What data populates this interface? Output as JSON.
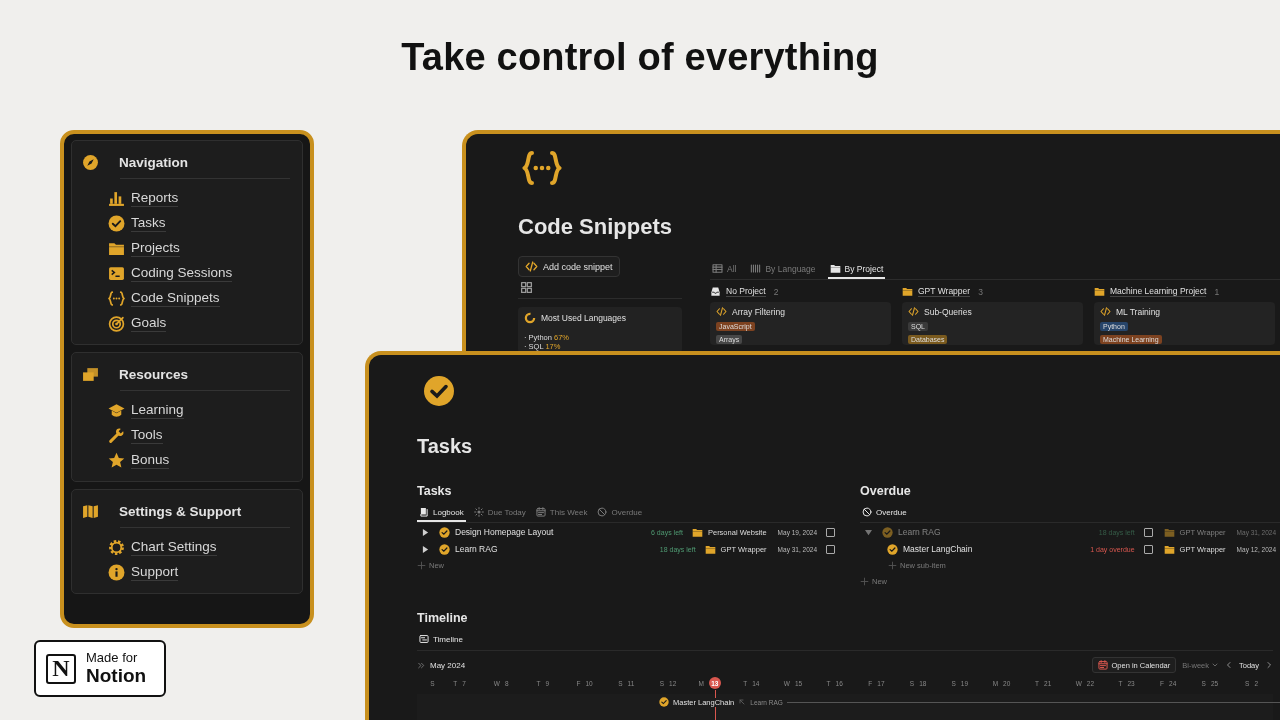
{
  "headline": "Take control of everything",
  "sidebar": {
    "sections": [
      {
        "title": "Navigation",
        "items": [
          "Reports",
          "Tasks",
          "Projects",
          "Coding Sessions",
          "Code Snippets",
          "Goals"
        ]
      },
      {
        "title": "Resources",
        "items": [
          "Learning",
          "Tools",
          "Bonus"
        ]
      },
      {
        "title": "Settings & Support",
        "items": [
          "Chart Settings",
          "Support"
        ]
      }
    ]
  },
  "badge": {
    "logo": "N",
    "line_1": "Made for",
    "line_2": "Notion"
  },
  "code_snippets": {
    "title": "Code Snippets",
    "add_button": "Add code snippet",
    "languages_card": {
      "title": "Most Used Languages",
      "entries": [
        {
          "label": "· Python",
          "share": "67%"
        },
        {
          "label": "· SQL",
          "share": "17%"
        }
      ]
    },
    "tabs": [
      {
        "label": "All",
        "selected": false
      },
      {
        "label": "By Language",
        "selected": false
      },
      {
        "label": "By Project",
        "selected": true
      }
    ],
    "groups": [
      {
        "name": "No Project",
        "count": "2",
        "card": {
          "title": "Array Filtering",
          "tags": [
            {
              "label": "JavaScript",
              "color": "#7d4220"
            },
            {
              "label": "Arrays",
              "color": "#474747"
            }
          ]
        }
      },
      {
        "name": "GPT Wrapper",
        "count": "3",
        "card": {
          "title": "Sub-Queries",
          "tags": [
            {
              "label": "SQL",
              "color": "#3a3a3a"
            },
            {
              "label": "Databases",
              "color": "#7a5a1e"
            }
          ]
        }
      },
      {
        "name": "Machine Learning Project",
        "count": "1",
        "card": {
          "title": "ML Training",
          "tags": [
            {
              "label": "Python",
              "color": "#27456a"
            },
            {
              "label": "Machine Learning",
              "color": "#7d4220"
            }
          ]
        }
      }
    ]
  },
  "tasks_page": {
    "title": "Tasks",
    "tasks_view": {
      "heading": "Tasks",
      "tabs": [
        {
          "label": "Logbook",
          "selected": true
        },
        {
          "label": "Due Today",
          "selected": false
        },
        {
          "label": "This Week",
          "selected": false
        },
        {
          "label": "Overdue",
          "selected": false
        }
      ],
      "rows": [
        {
          "title": "Design Homepage Layout",
          "due_note": "6 days left",
          "overdue": false,
          "project": "Personal Website",
          "date": "May 19, 2024",
          "checked": false,
          "expanded": false
        },
        {
          "title": "Learn RAG",
          "due_note": "18 days left",
          "overdue": false,
          "project": "GPT Wrapper",
          "date": "May 31, 2024",
          "checked": false,
          "expanded": false
        }
      ],
      "new_label": "New"
    },
    "overdue_view": {
      "heading": "Overdue",
      "view_label": "Overdue",
      "rows": [
        {
          "title": "Learn RAG",
          "due_note": "18 days left",
          "overdue": false,
          "project": "GPT Wrapper",
          "date": "May 31, 2024",
          "checked": false,
          "expanded": true,
          "faded": true,
          "children": [
            {
              "title": "Master LangChain",
              "due_note": "1 day overdue",
              "overdue": true,
              "project": "GPT Wrapper",
              "date": "May 12, 2024",
              "checked": false,
              "faded": false
            }
          ]
        }
      ],
      "new_sub_label": "New sub-item",
      "new_label": "New"
    },
    "timeline": {
      "heading": "Timeline",
      "view_label": "Timeline",
      "month": "May 2024",
      "open_calendar": "Open in Calendar",
      "range": "Bi-week",
      "today_button": "Today",
      "days": [
        {
          "weekday": "S",
          "today": false
        },
        {
          "weekday": "T",
          "date": "7",
          "today": false
        },
        {
          "weekday": "W",
          "date": "8",
          "today": false
        },
        {
          "weekday": "T",
          "date": "9",
          "today": false
        },
        {
          "weekday": "F",
          "date": "10",
          "today": false
        },
        {
          "weekday": "S",
          "date": "11",
          "today": false
        },
        {
          "weekday": "S",
          "date": "12",
          "today": false
        },
        {
          "weekday": "M",
          "date": "13",
          "today": true
        },
        {
          "weekday": "T",
          "date": "14",
          "today": false
        },
        {
          "weekday": "W",
          "date": "15",
          "today": false
        },
        {
          "weekday": "T",
          "date": "16",
          "today": false
        },
        {
          "weekday": "F",
          "date": "17",
          "today": false
        },
        {
          "weekday": "S",
          "date": "18",
          "today": false
        },
        {
          "weekday": "S",
          "date": "19",
          "today": false
        },
        {
          "weekday": "M",
          "date": "20",
          "today": false
        },
        {
          "weekday": "T",
          "date": "21",
          "today": false
        },
        {
          "weekday": "W",
          "date": "22",
          "today": false
        },
        {
          "weekday": "T",
          "date": "23",
          "today": false
        },
        {
          "weekday": "F",
          "date": "24",
          "today": false
        },
        {
          "weekday": "S",
          "date": "25",
          "today": false
        },
        {
          "weekday": "S",
          "date": "2",
          "today": false
        }
      ],
      "bar": {
        "title": "Master LangChain",
        "parent": "Learn RAG"
      }
    }
  }
}
